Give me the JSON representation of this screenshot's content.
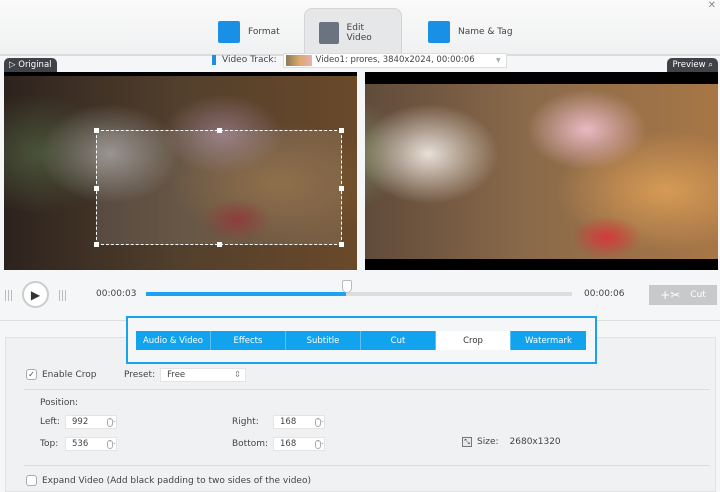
{
  "header": {
    "tabs": [
      {
        "label": "Format",
        "icon": "format-icon"
      },
      {
        "label": "Edit Video",
        "icon": "edit-video-icon"
      },
      {
        "label": "Name & Tag",
        "icon": "name-tag-icon"
      }
    ],
    "active": "Edit Video"
  },
  "track": {
    "label": "Video Track:",
    "value": "Video1: prores, 3840x2024, 00:00:06"
  },
  "labels": {
    "original": "Original",
    "preview": "Preview"
  },
  "player": {
    "current": "00:00:03",
    "total": "00:00:06",
    "progress": 0.47,
    "cut_label": "Cut"
  },
  "edit_tabs": [
    "Audio & Video",
    "Effects",
    "Subtitle",
    "Cut",
    "Crop",
    "Watermark"
  ],
  "active_edit_tab": "Crop",
  "crop": {
    "enable_label": "Enable Crop",
    "enabled": true,
    "preset_label": "Preset:",
    "preset": "Free",
    "position_label": "Position:",
    "left_label": "Left:",
    "left": "992",
    "right_label": "Right:",
    "right": "168",
    "top_label": "Top:",
    "top": "536",
    "bottom_label": "Bottom:",
    "bottom": "168",
    "size_label": "Size:",
    "size": "2680x1320",
    "expand_label": "Expand Video (Add black padding to two sides of the video)",
    "expand": false
  },
  "colors": {
    "accent": "#12a3ee"
  }
}
